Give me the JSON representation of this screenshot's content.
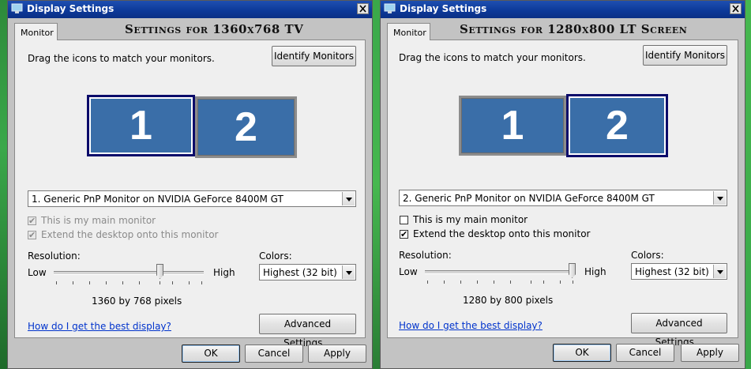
{
  "windows": [
    {
      "title": "Display Settings",
      "tab": "Monitor",
      "heading": "Settings for 1360x768 TV",
      "instruction": "Drag the icons to match your monitors.",
      "identify_button": "Identify Monitors",
      "monitors": [
        {
          "label": "1",
          "selected": true
        },
        {
          "label": "2",
          "selected": false
        }
      ],
      "display_select": "1. Generic PnP Monitor on NVIDIA GeForce 8400M GT",
      "main_monitor": {
        "label": "This is my main monitor",
        "checked": true,
        "enabled": false
      },
      "extend_desktop": {
        "label": "Extend the desktop onto this monitor",
        "checked": true,
        "enabled": false
      },
      "resolution_label": "Resolution:",
      "low_label": "Low",
      "high_label": "High",
      "resolution_level": 0.75,
      "resolution_value": "1360 by 768 pixels",
      "colors_label": "Colors:",
      "colors_select": "Highest (32 bit)",
      "help_link": "How do I get the best display?",
      "advanced_button": "Advanced Settings...",
      "ok_button": "OK",
      "cancel_button": "Cancel",
      "apply_button": "Apply"
    },
    {
      "title": "Display Settings",
      "tab": "Monitor",
      "heading": "Settings for 1280x800 LT Screen",
      "instruction": "Drag the icons to match your monitors.",
      "identify_button": "Identify Monitors",
      "monitors": [
        {
          "label": "1",
          "selected": false
        },
        {
          "label": "2",
          "selected": true
        }
      ],
      "display_select": "2. Generic PnP Monitor on NVIDIA GeForce 8400M GT",
      "main_monitor": {
        "label": "This is my main monitor",
        "checked": false,
        "enabled": true
      },
      "extend_desktop": {
        "label": "Extend the desktop onto this monitor",
        "checked": true,
        "enabled": true
      },
      "resolution_label": "Resolution:",
      "low_label": "Low",
      "high_label": "High",
      "resolution_level": 1.0,
      "resolution_value": "1280 by 800 pixels",
      "colors_label": "Colors:",
      "colors_select": "Highest (32 bit)",
      "help_link": "How do I get the best display?",
      "advanced_button": "Advanced Settings...",
      "ok_button": "OK",
      "cancel_button": "Cancel",
      "apply_button": "Apply"
    }
  ],
  "colors": {
    "titlebar": "#0d3a9a",
    "monitor_fill": "#3a6ea8",
    "link": "#0033cc",
    "desktop": "#3aa84a"
  }
}
